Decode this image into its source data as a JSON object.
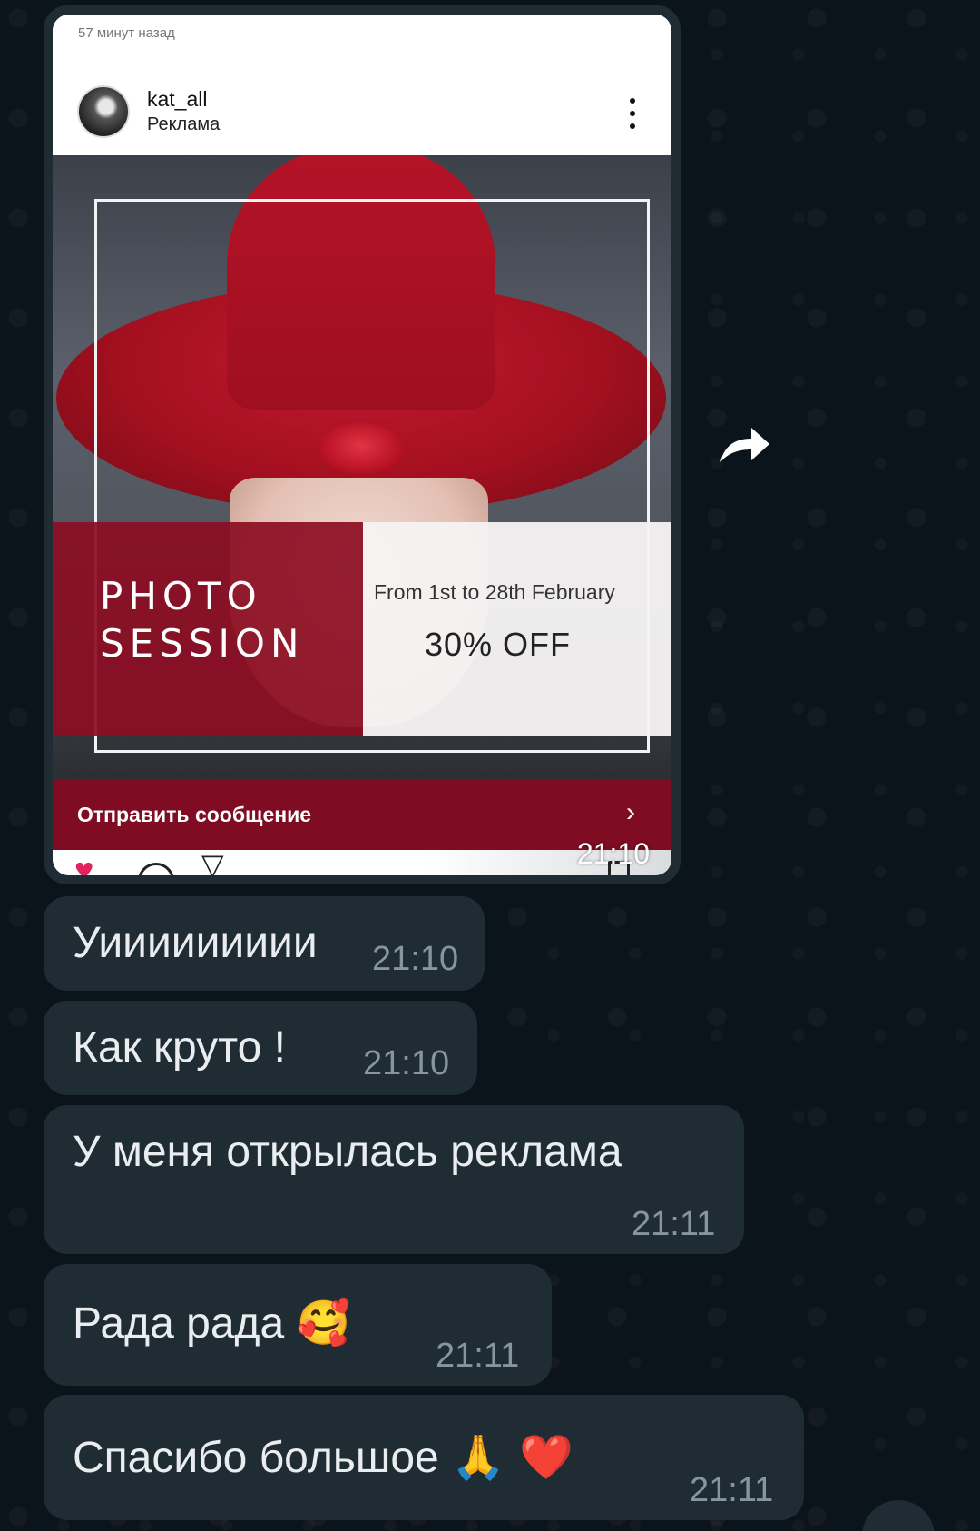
{
  "shared_post": {
    "time_ago": "57 минут назад",
    "username": "kat_all",
    "subtitle": "Реклама",
    "ad": {
      "title_line1": "PHOTO",
      "title_line2": "SESSION",
      "dates": "From 1st to 28th February",
      "discount": "30% OFF"
    },
    "cta_label": "Отправить сообщение",
    "cta_chevron": "›",
    "icons": {
      "more": "more-vertical-icon",
      "like": "heart-icon",
      "comment": "comment-icon",
      "share": "send-icon",
      "save": "bookmark-icon"
    }
  },
  "image_message_time": "21:10",
  "forward_icon": "forward-icon",
  "messages": [
    {
      "text": "Уиииииииии",
      "time": "21:10"
    },
    {
      "text": "Как круто !",
      "time": "21:10"
    },
    {
      "text": "У меня открылась реклама",
      "time": "21:11"
    },
    {
      "text": "Рада рада",
      "emoji": "🥰",
      "time": "21:11"
    },
    {
      "text": "Спасибо большое",
      "emoji": "🙏 ❤️",
      "time": "21:11"
    }
  ],
  "colors": {
    "background": "#0b141a",
    "bubble": "#1f2c33",
    "text": "#e9edef",
    "time": "#8696a0",
    "ad_red": "#8c0e24"
  }
}
